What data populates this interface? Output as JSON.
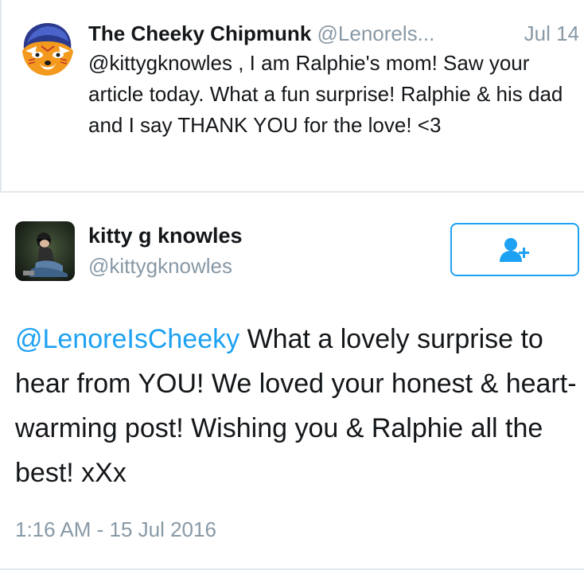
{
  "reply_tweet": {
    "author_name": "The Cheeky Chipmunk",
    "author_handle": "@Lenorels...",
    "date": "Jul 14",
    "text": "@kittygknowles , I am Ralphie's mom! Saw your article today. What a fun surprise! Ralphie & his dad and I say THANK YOU for the love! <3"
  },
  "main_tweet": {
    "author_name": "kitty g knowles",
    "author_handle": "@kittygknowles",
    "mention": "@LenoreIsCheeky",
    "text": " What a lovely surprise to hear from YOU! We loved your honest & heart-warming post! Wishing you & Ralphie all the best! xXx",
    "timestamp": "1:16 AM - 15 Jul 2016",
    "follow_icon": "person-add-icon"
  },
  "colors": {
    "link_blue": "#1da1f2",
    "muted_gray": "#8899a6",
    "text_dark": "#14171a",
    "divider": "#e1e8ed"
  }
}
